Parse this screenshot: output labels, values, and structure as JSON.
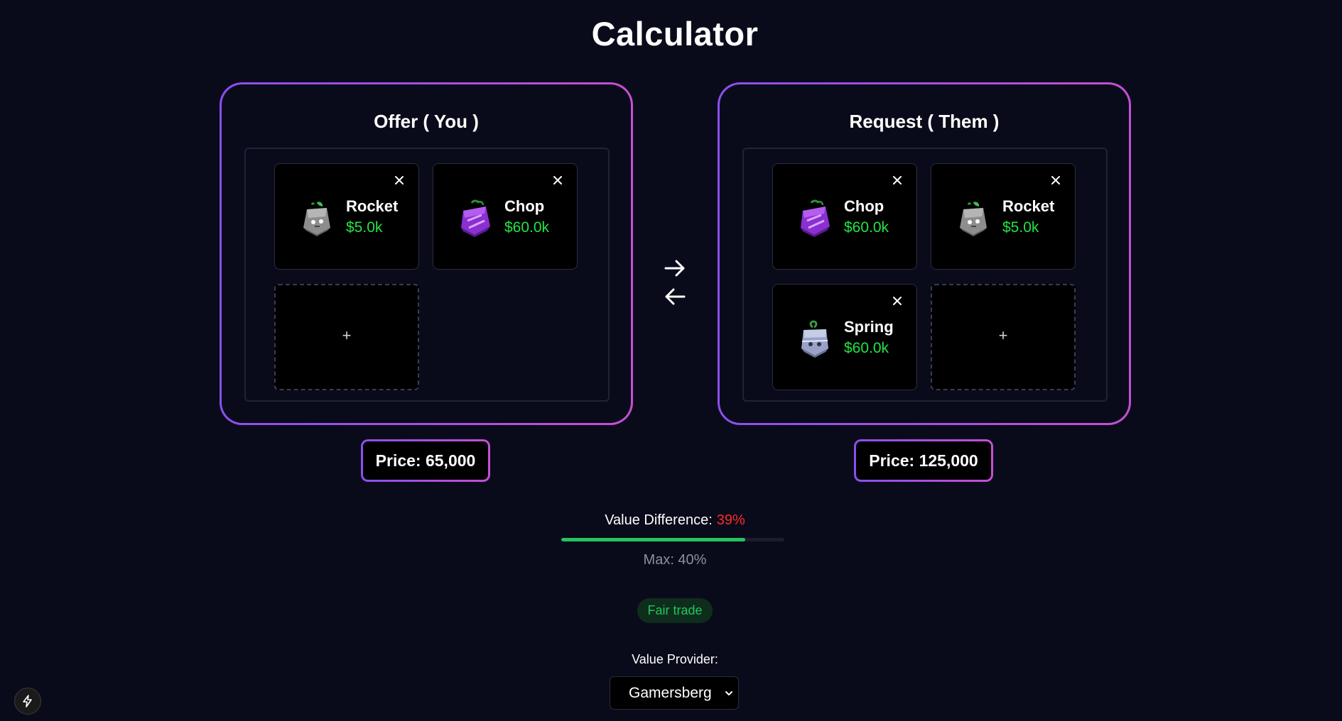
{
  "page": {
    "title": "Calculator"
  },
  "offer": {
    "heading": "Offer ( You )",
    "items": [
      {
        "name": "Rocket",
        "price": "$5.0k",
        "icon": "rocket-fruit-icon"
      },
      {
        "name": "Chop",
        "price": "$60.0k",
        "icon": "chop-fruit-icon"
      }
    ],
    "add_label": "+",
    "price_label": "Price: 65,000"
  },
  "request": {
    "heading": "Request ( Them )",
    "items": [
      {
        "name": "Chop",
        "price": "$60.0k",
        "icon": "chop-fruit-icon"
      },
      {
        "name": "Rocket",
        "price": "$5.0k",
        "icon": "rocket-fruit-icon"
      },
      {
        "name": "Spring",
        "price": "$60.0k",
        "icon": "spring-fruit-icon"
      }
    ],
    "add_label": "+",
    "price_label": "Price: 125,000"
  },
  "value": {
    "label": "Value Difference:",
    "percent": "39%",
    "bar_fill_fraction": 0.825,
    "max_label": "Max: 40%",
    "verdict": "Fair trade"
  },
  "provider": {
    "label": "Value Provider:",
    "selected": "Gamersberg"
  },
  "colors": {
    "background": "#0a0b1a",
    "accent_gradient_start": "#8a4ff0",
    "accent_gradient_end": "#c64fd4",
    "price_green": "#22e344",
    "diff_red": "#ff2a2a",
    "fair_green": "#22c55e"
  }
}
